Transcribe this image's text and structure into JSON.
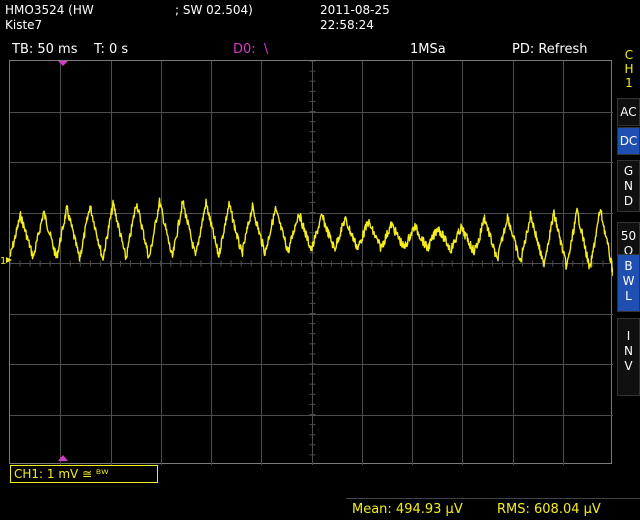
{
  "header": {
    "model": "HMO3524 (HW",
    "sw": "; SW 02.504)",
    "name": "Kiste7",
    "date": "2011-08-25",
    "time": "22:58:24"
  },
  "status": {
    "timebase": "TB: 50 ms",
    "trigger_time": "T: 0 s",
    "digital": "D0:  \\",
    "sample_rate": "1MSa",
    "pd": "PD: Refresh"
  },
  "channel_sidebar": {
    "channel_label": [
      "C",
      "H",
      "1"
    ],
    "buttons": [
      {
        "label": [
          "AC"
        ],
        "active": false
      },
      {
        "label": [
          "DC"
        ],
        "active": true
      },
      {
        "label": [
          "G",
          "N",
          "D"
        ],
        "active": false
      },
      {
        "label": [
          "50",
          "Ω"
        ],
        "active": false
      },
      {
        "label": [
          "B",
          "W",
          "L"
        ],
        "active": true
      },
      {
        "label": [
          "I",
          "N",
          "V"
        ],
        "active": false
      }
    ]
  },
  "channel_info": "CH1: 1 mV ≅ ᴮᵂ",
  "ground_marker": "1",
  "measurements": {
    "mean": "Mean: 494.93 µV",
    "rms": "RMS: 608.04 µV"
  },
  "colors": {
    "trace": "#f5ee1a",
    "grid": "#4d4d4d",
    "marker": "#d23cc8",
    "active_button": "#1f4fb0"
  }
}
